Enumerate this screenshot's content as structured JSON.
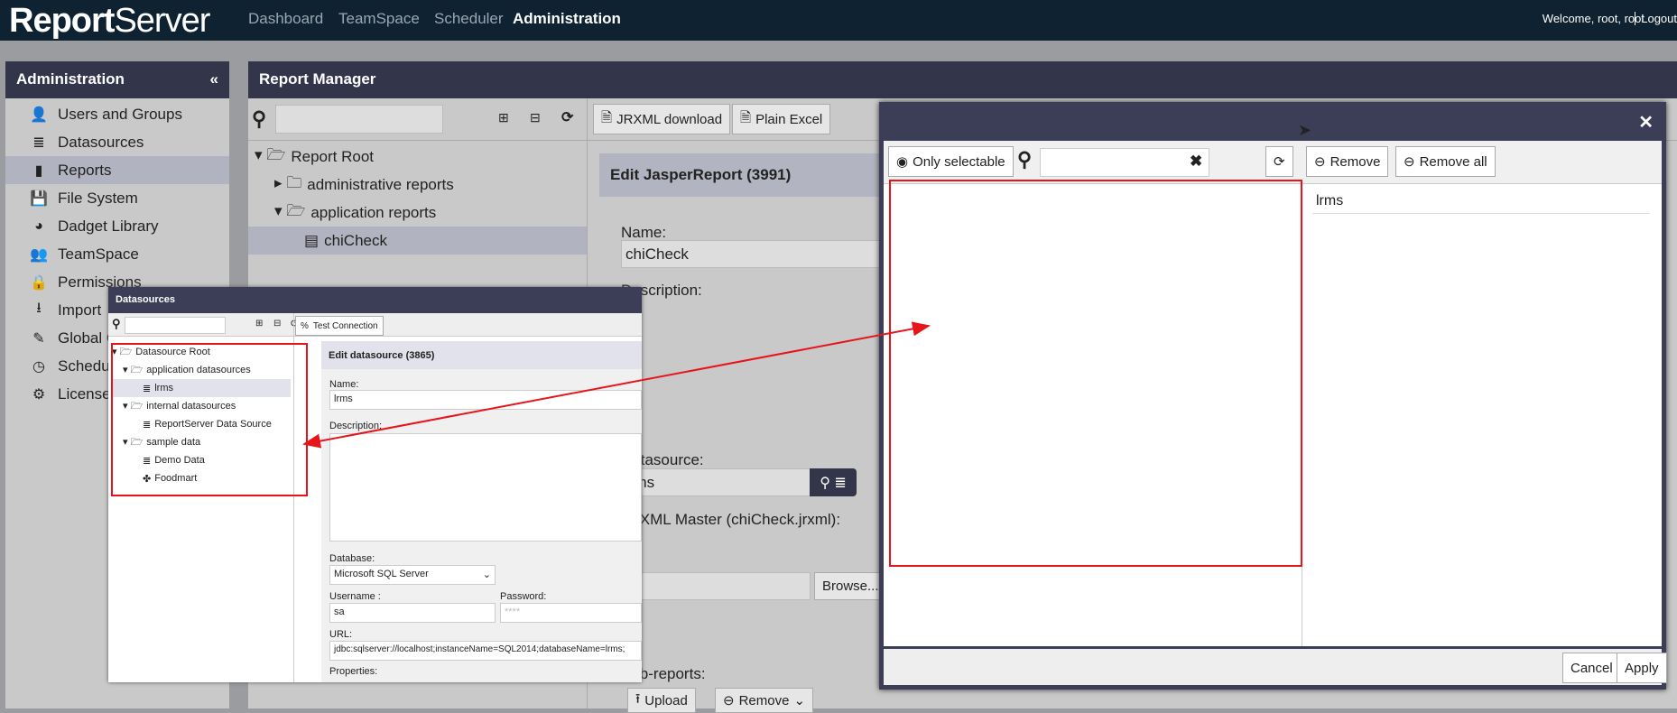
{
  "topbar": {
    "logo_a": "Report",
    "logo_b": "Server",
    "nav": [
      "Dashboard",
      "TeamSpace",
      "Scheduler",
      "Administration"
    ],
    "welcome": "Welcome, root, root",
    "logout": "Logout"
  },
  "sidebar": {
    "title": "Administration",
    "collapse_icon": "double-chevron-left",
    "items": [
      {
        "label": "Users and Groups",
        "icon": "user"
      },
      {
        "label": "Datasources",
        "icon": "database"
      },
      {
        "label": "Reports",
        "icon": "file"
      },
      {
        "label": "File System",
        "icon": "floppy"
      },
      {
        "label": "Dadget Library",
        "icon": "dashboard"
      },
      {
        "label": "TeamSpace",
        "icon": "users"
      },
      {
        "label": "Permissions",
        "icon": "lock"
      },
      {
        "label": "Import",
        "icon": "download"
      },
      {
        "label": "Global C",
        "icon": "edit"
      },
      {
        "label": "Schedu",
        "icon": "clock"
      },
      {
        "label": "License",
        "icon": "gear"
      }
    ]
  },
  "report_manager": {
    "title": "Report Manager",
    "tree": [
      "Report Root",
      "administrative reports",
      "application reports",
      "chiCheck"
    ],
    "toolbar": {
      "jrxml": "JRXML download",
      "excel": "Plain Excel"
    },
    "form": {
      "title": "Edit JasperReport (3991)",
      "name_label": "Name:",
      "name_value": "chiCheck",
      "description_label": "Description:",
      "datasource_label": "Datasource:",
      "datasource_value": "lrms",
      "jrxml_label": "JRXML Master (chiCheck.jrxml):",
      "browse": "Browse...",
      "subreports_label": "Sub-reports:",
      "upload": "Upload",
      "remove": "Remove"
    }
  },
  "datasources": {
    "title": "Datasources",
    "test_connection": "Test Connection",
    "tree": [
      "Datasource Root",
      "application datasources",
      "lrms",
      "internal datasources",
      "ReportServer Data Source",
      "sample data",
      "Demo Data",
      "Foodmart"
    ],
    "form": {
      "title": "Edit datasource (3865)",
      "name_label": "Name:",
      "name_value": "lrms",
      "description_label": "Description:",
      "database_label": "Database:",
      "database_value": "Microsoft SQL Server",
      "username_label": "Username :",
      "username_value": "sa",
      "password_label": "Password:",
      "password_value": "****",
      "url_label": "URL:",
      "url_value": "jdbc:sqlserver://localhost;instanceName=SQL2014;databaseName=lrms;",
      "properties_label": "Properties:"
    }
  },
  "dialog": {
    "only_selectable": "Only selectable",
    "search_value": "",
    "remove": "Remove",
    "remove_all": "Remove all",
    "selected": [
      "lrms"
    ],
    "cancel": "Cancel",
    "apply": "Apply"
  },
  "colors": {
    "topbar": "#0f2231",
    "panel_header": "#33364b",
    "highlight": "#e8141b"
  }
}
